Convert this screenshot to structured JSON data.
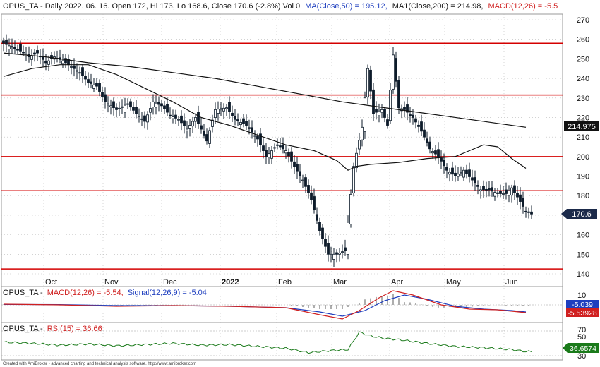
{
  "header": {
    "title_line": "OPUS_TA - Daily 2022. 06. 16. Open 172, Hi 173, Lo 168.6, Close 170.6 (-2.8%) Vol 0",
    "ma50_label": "MA(Close,50) = 195.12,",
    "ma200_label": "MA1(Close,200) = 214.98,",
    "macd_label": "MACD(12,26) = -5.5"
  },
  "macd_panel": {
    "title_prefix": "OPUS_TA -",
    "macd_text": "MACD(12,26) = -5.54,",
    "signal_text": "Signal(12,26,9) = -5.04",
    "signal_badge": "-5.039",
    "macd_badge": "-5.53928",
    "y_ticks": [
      "10",
      "0"
    ]
  },
  "rsi_panel": {
    "title_prefix": "OPUS_TA -",
    "rsi_text": "RSI(15) = 36.66",
    "rsi_badge": "36.6574",
    "y_ticks": [
      "70",
      "50",
      "30"
    ]
  },
  "footer": "Created with AmiBroker - advanced charting and technical analysis software. http://www.amibroker.com",
  "price_badges": {
    "ma200": "214.975",
    "close": "170.6"
  },
  "colors": {
    "candle": "#0d1b2a",
    "support_line": "#d40000",
    "ma_line": "#111111",
    "macd_line": "#1f3fbf",
    "signal_line": "#d02020",
    "rsi_line": "#1a7a1a",
    "grid": "#b8b8b8"
  },
  "chart_data": {
    "type": "candlestick",
    "ylim": [
      136,
      278
    ],
    "y_ticks": [
      140,
      150,
      160,
      170,
      180,
      190,
      200,
      210,
      220,
      230,
      240,
      250,
      260,
      270
    ],
    "x_labels": [
      "Oct",
      "Nov",
      "Dec",
      "2022",
      "Feb",
      "Mar",
      "Apr",
      "May",
      "Jun"
    ],
    "horizontal_lines": [
      258,
      231.5,
      200,
      182.5,
      142.5
    ],
    "price_anchors": [
      [
        0,
        258
      ],
      [
        3,
        256
      ],
      [
        6,
        254
      ],
      [
        9,
        251
      ],
      [
        12,
        253
      ],
      [
        15,
        248
      ],
      [
        18,
        251
      ],
      [
        21,
        249
      ],
      [
        24,
        246
      ],
      [
        27,
        243
      ],
      [
        30,
        238
      ],
      [
        33,
        236
      ],
      [
        36,
        228
      ],
      [
        40,
        224
      ],
      [
        44,
        227
      ],
      [
        47,
        222
      ],
      [
        50,
        218
      ],
      [
        53,
        228
      ],
      [
        56,
        226
      ],
      [
        59,
        221
      ],
      [
        62,
        219
      ],
      [
        65,
        214
      ],
      [
        68,
        220
      ],
      [
        72,
        208
      ],
      [
        75,
        224
      ],
      [
        79,
        225
      ],
      [
        82,
        219
      ],
      [
        86,
        216
      ],
      [
        90,
        209
      ],
      [
        93,
        200
      ],
      [
        97,
        206
      ],
      [
        100,
        203
      ],
      [
        103,
        195
      ],
      [
        106,
        188
      ],
      [
        109,
        178
      ],
      [
        112,
        162
      ],
      [
        115,
        150
      ],
      [
        118,
        150
      ],
      [
        121,
        152
      ],
      [
        124,
        195
      ],
      [
        127,
        215
      ],
      [
        129,
        245
      ],
      [
        131,
        222
      ],
      [
        134,
        224
      ],
      [
        136,
        216
      ],
      [
        138,
        252
      ],
      [
        140,
        225
      ],
      [
        142,
        224
      ],
      [
        145,
        220
      ],
      [
        148,
        213
      ],
      [
        151,
        204
      ],
      [
        154,
        200
      ],
      [
        157,
        193
      ],
      [
        160,
        190
      ],
      [
        163,
        193
      ],
      [
        166,
        188
      ],
      [
        169,
        183
      ],
      [
        172,
        183
      ],
      [
        175,
        181
      ],
      [
        178,
        181
      ],
      [
        180,
        184
      ],
      [
        183,
        177
      ],
      [
        185,
        172
      ],
      [
        187,
        170.6
      ]
    ],
    "ma50": [
      [
        0,
        241
      ],
      [
        10,
        245
      ],
      [
        20,
        247
      ],
      [
        30,
        247
      ],
      [
        40,
        242
      ],
      [
        50,
        235
      ],
      [
        60,
        228
      ],
      [
        70,
        220
      ],
      [
        80,
        216
      ],
      [
        90,
        211
      ],
      [
        100,
        206
      ],
      [
        110,
        203
      ],
      [
        118,
        198
      ],
      [
        122,
        193
      ],
      [
        125,
        195
      ],
      [
        130,
        196
      ],
      [
        140,
        197
      ],
      [
        150,
        199
      ],
      [
        160,
        200
      ],
      [
        165,
        203
      ],
      [
        170,
        206
      ],
      [
        175,
        205
      ],
      [
        180,
        199
      ],
      [
        185,
        194
      ]
    ],
    "ma200": [
      [
        0,
        253
      ],
      [
        15,
        251
      ],
      [
        30,
        248
      ],
      [
        45,
        246
      ],
      [
        60,
        243
      ],
      [
        75,
        240
      ],
      [
        90,
        236
      ],
      [
        105,
        232
      ],
      [
        120,
        228
      ],
      [
        135,
        225
      ],
      [
        150,
        222
      ],
      [
        165,
        219
      ],
      [
        175,
        217
      ],
      [
        185,
        215
      ]
    ],
    "macd": [
      [
        0,
        0.5
      ],
      [
        20,
        0
      ],
      [
        40,
        -1
      ],
      [
        60,
        -0.5
      ],
      [
        80,
        -1
      ],
      [
        100,
        -2
      ],
      [
        112,
        -7
      ],
      [
        120,
        -10
      ],
      [
        126,
        -4
      ],
      [
        133,
        5
      ],
      [
        138,
        10
      ],
      [
        145,
        7
      ],
      [
        155,
        0
      ],
      [
        165,
        -3
      ],
      [
        175,
        -3.5
      ],
      [
        185,
        -5.5
      ]
    ],
    "signal": [
      [
        0,
        0.3
      ],
      [
        20,
        0.2
      ],
      [
        40,
        -0.5
      ],
      [
        60,
        -0.5
      ],
      [
        80,
        -1
      ],
      [
        100,
        -2
      ],
      [
        112,
        -5
      ],
      [
        120,
        -8
      ],
      [
        128,
        -4
      ],
      [
        135,
        3
      ],
      [
        142,
        7
      ],
      [
        150,
        4
      ],
      [
        160,
        -1
      ],
      [
        170,
        -3
      ],
      [
        180,
        -4
      ],
      [
        185,
        -5
      ]
    ],
    "rsi": [
      [
        0,
        52
      ],
      [
        10,
        50
      ],
      [
        20,
        47
      ],
      [
        30,
        49
      ],
      [
        40,
        46
      ],
      [
        50,
        48
      ],
      [
        60,
        50
      ],
      [
        70,
        47
      ],
      [
        80,
        48
      ],
      [
        90,
        45
      ],
      [
        100,
        42
      ],
      [
        108,
        35
      ],
      [
        115,
        38
      ],
      [
        122,
        40
      ],
      [
        126,
        68
      ],
      [
        130,
        62
      ],
      [
        135,
        58
      ],
      [
        140,
        56
      ],
      [
        150,
        50
      ],
      [
        160,
        45
      ],
      [
        170,
        43
      ],
      [
        180,
        40
      ],
      [
        185,
        36.7
      ]
    ]
  }
}
